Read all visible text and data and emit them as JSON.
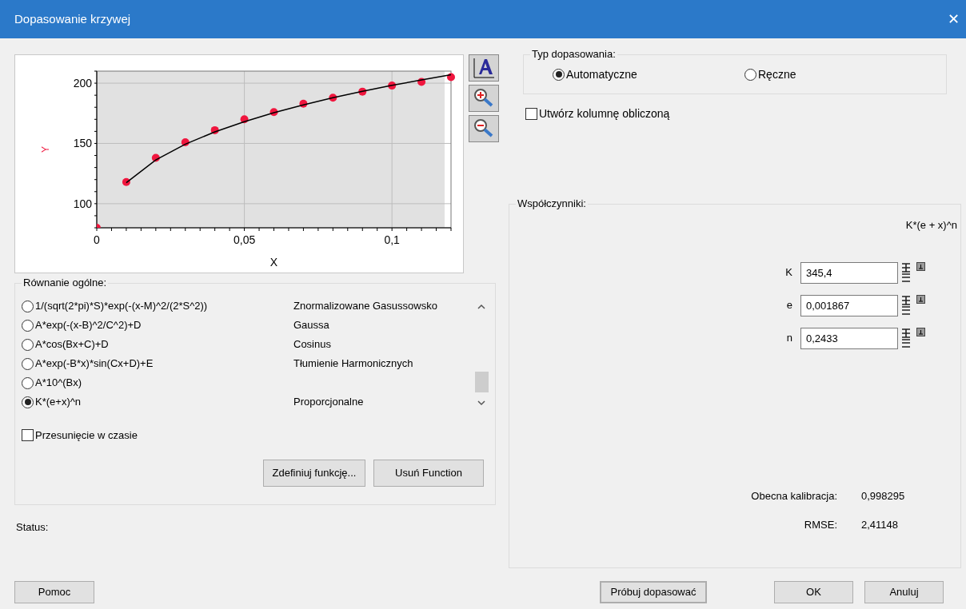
{
  "window": {
    "title": "Dopasowanie krzywej",
    "close": "✕"
  },
  "chart": {
    "chart_data": {
      "type": "scatter",
      "xlabel": "X",
      "ylabel": "Y",
      "x": [
        0,
        0.01,
        0.02,
        0.03,
        0.04,
        0.05,
        0.06,
        0.07,
        0.08,
        0.09,
        0.1,
        0.11,
        0.12
      ],
      "series": [
        {
          "type": "scatter",
          "color": "#f0163e",
          "values": [
            80,
            118,
            138,
            151,
            161,
            170,
            176,
            183,
            188,
            193,
            198,
            201,
            205
          ]
        },
        {
          "type": "line",
          "color": "#000000",
          "values": [
            null,
            117.4,
            136.3,
            149.4,
            159.6,
            168.1,
            175.5,
            182.0,
            187.9,
            193.2,
            198.2,
            202.7,
            207.0
          ]
        }
      ],
      "xlim": [
        0,
        0.12
      ],
      "ylim": [
        80,
        210
      ],
      "xticks": [
        {
          "value": 0,
          "label": "0"
        },
        {
          "value": 0.05,
          "label": "0,05"
        },
        {
          "value": 0.1,
          "label": "0,1"
        }
      ],
      "yticks": [
        100,
        150,
        200
      ],
      "grid": true
    }
  },
  "equations": {
    "title": "Równanie ogólne:",
    "items": [
      {
        "formula": "1/(sqrt(2*pi)*S)*exp(-(x-M)^2/(2*S^2))",
        "name": "Znormalizowane Gasussowsko",
        "selected": false
      },
      {
        "formula": "A*exp(-(x-B)^2/C^2)+D",
        "name": "Gaussa",
        "selected": false
      },
      {
        "formula": "A*cos(Bx+C)+D",
        "name": "Cosinus",
        "selected": false
      },
      {
        "formula": "A*exp(-B*x)*sin(Cx+D)+E",
        "name": "Tłumienie Harmonicznych",
        "selected": false
      },
      {
        "formula": "A*10^(Bx)",
        "selected": false
      },
      {
        "formula": "K*(e+x)^n",
        "name": "Proporcjonalne",
        "selected": true
      }
    ],
    "time_shift": {
      "label": "Przesunięcie w czasie",
      "checked": false
    },
    "buttons": [
      "Zdefiniuj funkcję...",
      "Usuń Function"
    ]
  },
  "status": {
    "label": "Status:"
  },
  "fit_type": {
    "title": "Typ dopasowania:",
    "options": [
      {
        "label": "Automatyczne",
        "selected": true
      },
      {
        "label": "Ręczne",
        "selected": false
      }
    ]
  },
  "computed_column": {
    "label": "Utwórz kolumnę obliczoną",
    "checked": false
  },
  "coefficients": {
    "title": "Współczynniki:",
    "formula": "K*(e + x)^n",
    "items": [
      {
        "name": "K",
        "value": "345,4"
      },
      {
        "name": "e",
        "value": "0,001867"
      },
      {
        "name": "n",
        "value": "0,2433"
      }
    ],
    "stats": [
      {
        "label": "Obecna kalibracja:",
        "value": "0,998295"
      },
      {
        "label": "RMSE:",
        "value": "2,41148"
      }
    ]
  },
  "footer": {
    "help": "Pomoc",
    "try_fit": "Próbuj dopasować",
    "ok": "OK",
    "cancel": "Anuluj"
  }
}
